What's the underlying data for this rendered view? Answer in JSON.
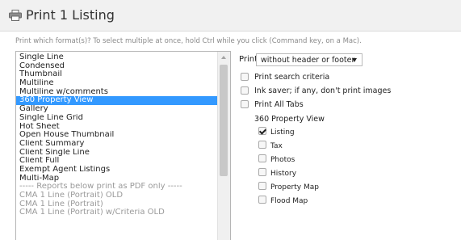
{
  "header": {
    "title": "Print 1 Listing",
    "icon": "printer-icon"
  },
  "instructions": "Print which format(s)? To select multiple at once, hold Ctrl while you click (Command key, on a Mac).",
  "formats": [
    {
      "label": "Single Line"
    },
    {
      "label": "Condensed"
    },
    {
      "label": "Thumbnail"
    },
    {
      "label": "Multiline"
    },
    {
      "label": "Multiline w/comments"
    },
    {
      "label": "360 Property View",
      "selected": true
    },
    {
      "label": "Gallery"
    },
    {
      "label": "Single Line Grid"
    },
    {
      "label": "Hot Sheet"
    },
    {
      "label": "Open House Thumbnail"
    },
    {
      "label": "Client Summary"
    },
    {
      "label": "Client Single Line"
    },
    {
      "label": "Client Full"
    },
    {
      "label": "Exempt Agent Listings"
    },
    {
      "label": "Multi-Map"
    },
    {
      "label": "----- Reports below print as PDF only -----",
      "disabled": true
    },
    {
      "label": "CMA 1 Line (Portrait) OLD",
      "disabled": true
    },
    {
      "label": "CMA 1 Line (Portrait)",
      "disabled": true
    },
    {
      "label": "CMA 1 Line (Portrait) w/Criteria OLD",
      "disabled": true
    }
  ],
  "print": {
    "label": "Print",
    "selected": "without header or footer"
  },
  "checkboxes": [
    {
      "label": "Print search criteria",
      "checked": false
    },
    {
      "label": "Ink saver; if any, don't print images",
      "checked": false
    },
    {
      "label": "Print All Tabs",
      "checked": false
    }
  ],
  "view_section": {
    "title": "360 Property View",
    "items": [
      {
        "label": "Listing",
        "checked": true
      },
      {
        "label": "Tax",
        "checked": false
      },
      {
        "label": "Photos",
        "checked": false
      },
      {
        "label": "History",
        "checked": false
      },
      {
        "label": "Property Map",
        "checked": false
      },
      {
        "label": "Flood Map",
        "checked": false
      }
    ]
  }
}
